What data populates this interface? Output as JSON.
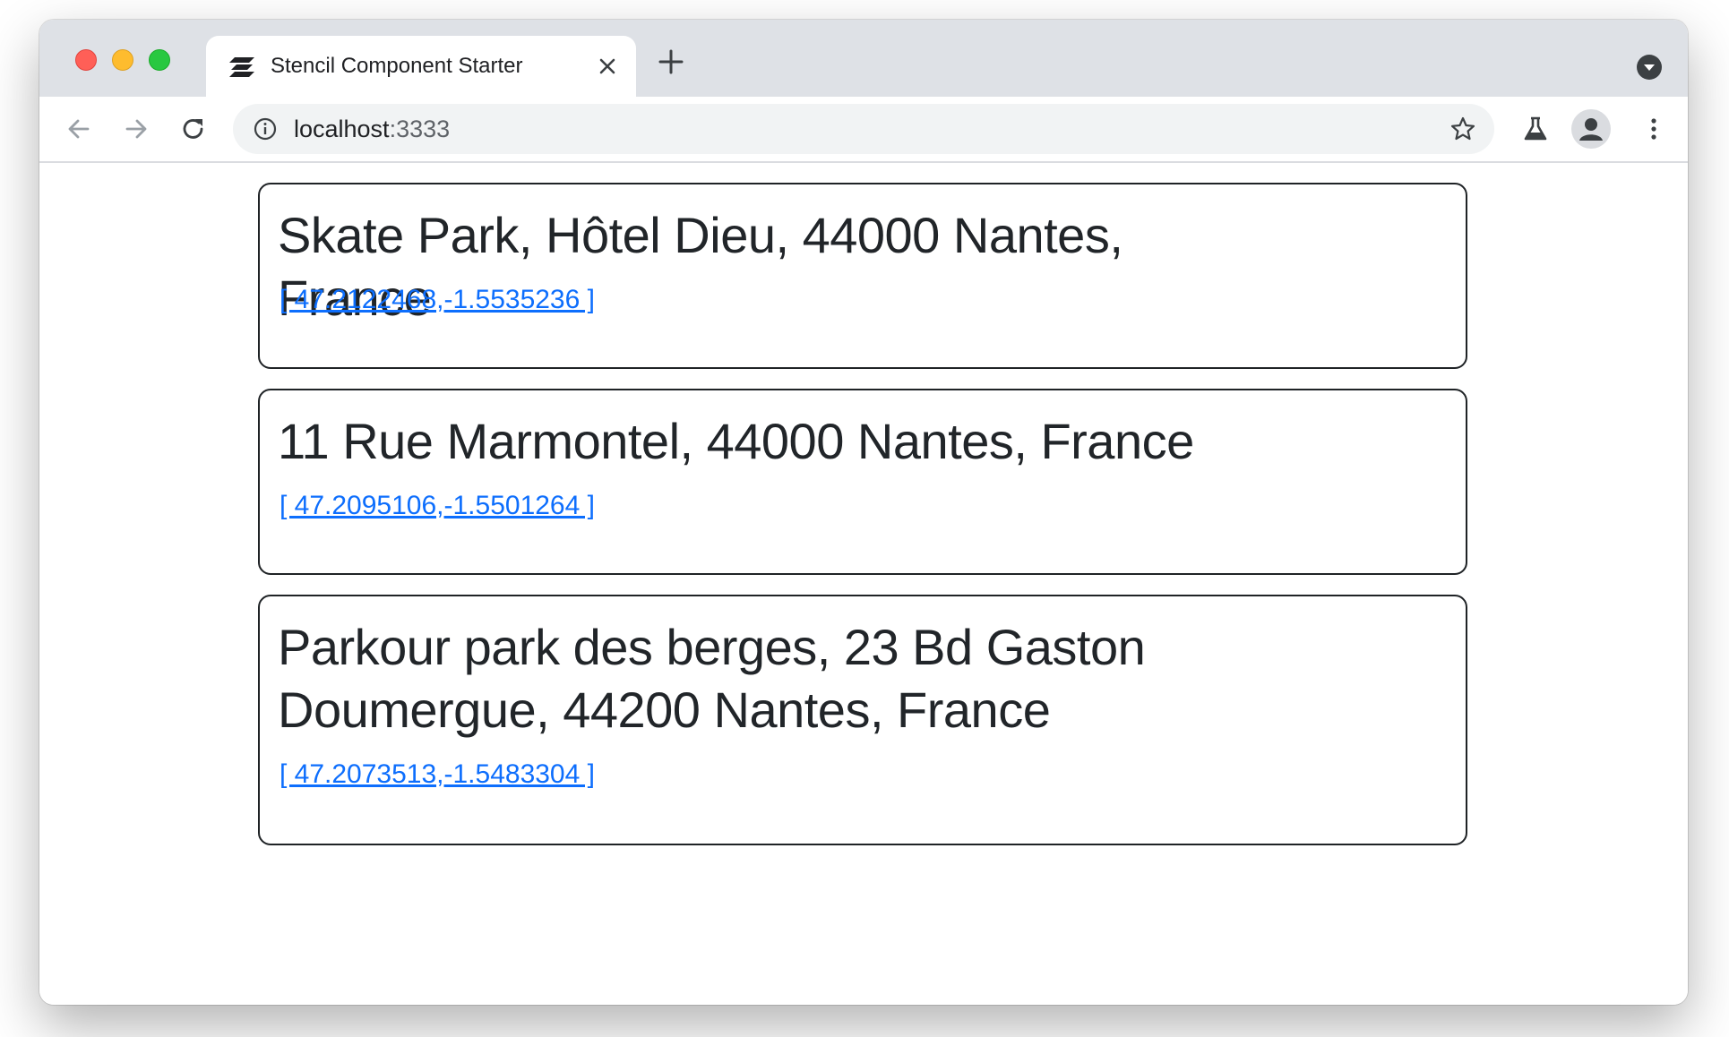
{
  "browser": {
    "tab": {
      "title": "Stencil Component Starter",
      "favicon": "stencil-logo-icon"
    },
    "address_bar": {
      "host": "localhost",
      "port": ":3333"
    },
    "icons": {
      "back": "arrow-left-icon",
      "forward": "arrow-right-icon",
      "reload": "reload-icon",
      "info": "info-icon",
      "bookmark": "star-icon",
      "labs": "flask-icon",
      "profile": "avatar-icon",
      "menu": "kebab-menu-icon",
      "tab_search": "chevron-down-icon"
    },
    "colors": {
      "link": "#0d6efd",
      "text": "#212529",
      "tabstrip": "#dee1e6"
    }
  },
  "places": [
    {
      "address": "Skate Park, Hôtel Dieu, 44000 Nantes, France",
      "coords": "[ 47.2122468,-1.5535236 ]"
    },
    {
      "address": "11 Rue Marmontel, 44000 Nantes, France",
      "coords": "[ 47.2095106,-1.5501264 ]"
    },
    {
      "address": "Parkour park des berges, 23 Bd Gaston Doumergue, 44200 Nantes, France",
      "coords": "[ 47.2073513,-1.5483304 ]"
    }
  ]
}
